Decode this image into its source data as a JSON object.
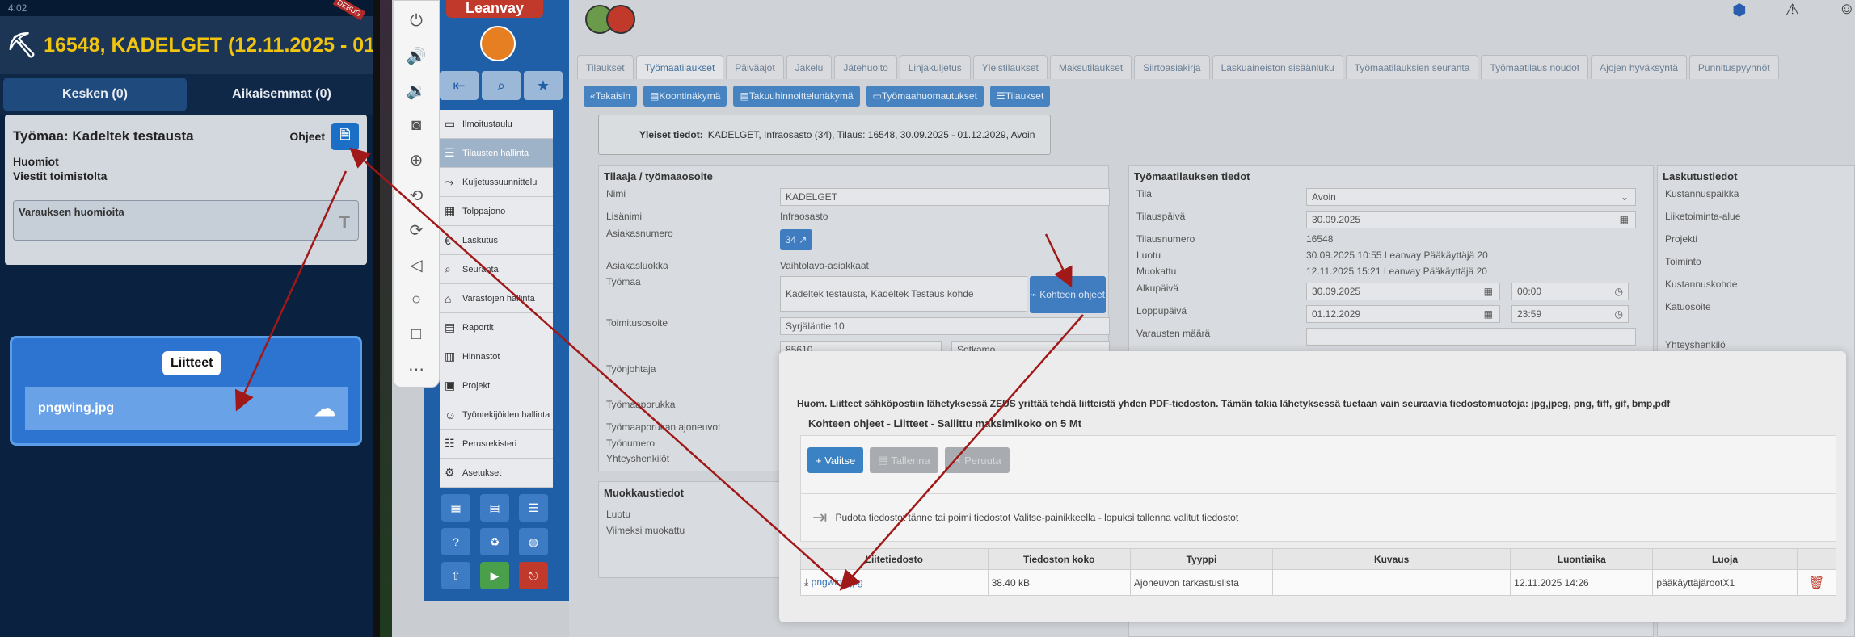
{
  "phone": {
    "status_time": "4:02",
    "debug_badge": "DEBUG",
    "header": "16548, KADELGET (12.11.2025 - 01",
    "tabs": [
      "Kesken (0)",
      "Aikaisemmat (0)"
    ],
    "worksite": {
      "title": "Työmaa: Kadeltek testausta",
      "instructions_label": "Ohjeet",
      "lines": [
        "Huomiot",
        "Viestit toimistolta"
      ],
      "reservation_label": "Varauksen huomioita"
    },
    "attachments_popup": {
      "title": "Liitteet",
      "file": "pngwing.jpg"
    }
  },
  "nav": {
    "logo": "Leanvay",
    "items": [
      "Ilmoitustaulu",
      "Tilausten hallinta",
      "Kuljetussuunnittelu",
      "Tolppajono",
      "Laskutus",
      "Seuranta",
      "Varastojen hallinta",
      "Raportit",
      "Hinnastot",
      "Projekti",
      "Työntekijöiden hallinta",
      "Perusrekisteri",
      "Asetukset"
    ]
  },
  "tabs": [
    "Tilaukset",
    "Työmaatilaukset",
    "Päiväajot",
    "Jakelu",
    "Jätehuolto",
    "Linjakuljetus",
    "Yleistilaukset",
    "Maksutilaukset",
    "Siirtoasiakirja",
    "Laskuaineiston sisäänluku",
    "Työmaatilauksien seuranta",
    "Työmaatilaus noudot",
    "Ajojen hyväksyntä",
    "Punnituspyynnöt"
  ],
  "actions": [
    "Takaisin",
    "Koontinäkymä",
    "Takuuhinnoittelunäkymä",
    "Työmaahuomautukset",
    "Tilaukset"
  ],
  "general": {
    "label": "Yleiset tiedot:",
    "value": "KADELGET, Infraosasto (34), Tilaus: 16548, 30.09.2025 - 01.12.2029, Avoin"
  },
  "customer": {
    "title": "Tilaaja / työmaaosoite",
    "nimi_label": "Nimi",
    "nimi": "KADELGET",
    "lisanimi_label": "Lisänimi",
    "lisanimi": "Infraosasto",
    "asiakasnumero_label": "Asiakasnumero",
    "asiakasnumero": "34",
    "asiakasluokka_label": "Asiakasluokka",
    "asiakasluokka": "Vaihtolava-asiakkaat",
    "tyomaa_label": "Työmaa",
    "tyomaa": "Kadeltek testausta, Kadeltek Testaus kohde",
    "kohteen_ohjeet": "Kohteen ohjeet",
    "toimitusosoite_label": "Toimitusosoite",
    "toimitusosoite": "Syrjäläntie 10",
    "postinumero": "85610",
    "kunta": "Sotkamo",
    "tyonjohtaja_label": "Työnjohtaja",
    "tyomaaporukka_label": "Työmaaporukka",
    "ajoneuvot_label": "Työmaaporukan ajoneuvot",
    "tyonumero_label": "Työnumero",
    "yhteyshenkilot_label": "Yhteyshenkilöt"
  },
  "edit": {
    "title": "Muokkaustiedot",
    "luotu_label": "Luotu",
    "muokattu_label": "Viimeksi muokattu"
  },
  "order": {
    "title": "Työmaatilauksen tiedot",
    "tila_label": "Tila",
    "tila": "Avoin",
    "tilauspaiva_label": "Tilauspäivä",
    "tilauspaiva": "30.09.2025",
    "tilausnumero_label": "Tilausnumero",
    "tilausnumero": "16548",
    "luotu_label": "Luotu",
    "luotu": "30.09.2025 10:55 Leanvay Pääkäyttäjä 20",
    "muokattu_label": "Muokattu",
    "muokattu": "12.11.2025 15:21 Leanvay Pääkäyttäjä 20",
    "alkupaiva_label": "Alkupäivä",
    "alkupaiva": "30.09.2025",
    "alkuaika": "00:00",
    "loppupaiva_label": "Loppupäivä",
    "loppupaiva": "01.12.2029",
    "loppuaika": "23:59",
    "varaukset_label": "Varausten määrä"
  },
  "billing": {
    "title": "Laskutustiedot",
    "fields": [
      "Kustannuspaikka",
      "Liiketoiminta-alue",
      "Projekti",
      "Toiminto",
      "Kustannuskohde",
      "Katuosoite"
    ],
    "yhteyshenkilo": "Yhteyshenkilö"
  },
  "modal": {
    "warning": "Huom. Liitteet sähköpostiin lähetyksessä ZEUS yrittää tehdä liitteistä yhden PDF-tiedoston. Tämän takia lähetyksessä tuetaan vain seuraavia tiedostomuotoja: jpg,jpeg, png, tiff, gif, bmp,pdf",
    "subtitle": "Kohteen ohjeet - Liitteet - Sallittu maksimikoko on 5 Mt",
    "buttons": [
      "Valitse",
      "Tallenna",
      "Peruuta"
    ],
    "drop_text": "Pudota tiedostot tänne tai poimi tiedostot Valitse-painikkeella - lopuksi tallenna valitut tiedostot",
    "columns": [
      "Liitetiedosto",
      "Tiedoston koko",
      "Tyyppi",
      "Kuvaus",
      "Luontiaika",
      "Luoja"
    ],
    "rows": [
      {
        "file": "pngwing.jpg",
        "size": "38.40 kB",
        "type": "Ajoneuvon tarkastuslista",
        "desc": "",
        "created": "12.11.2025 14:26",
        "creator": "pääkäyttäjärootX1"
      }
    ]
  },
  "colors": {
    "accent": "#3b82c4",
    "arrow": "#a01818",
    "phone_bg": "#0a2140",
    "header_text": "#f1c40f"
  }
}
